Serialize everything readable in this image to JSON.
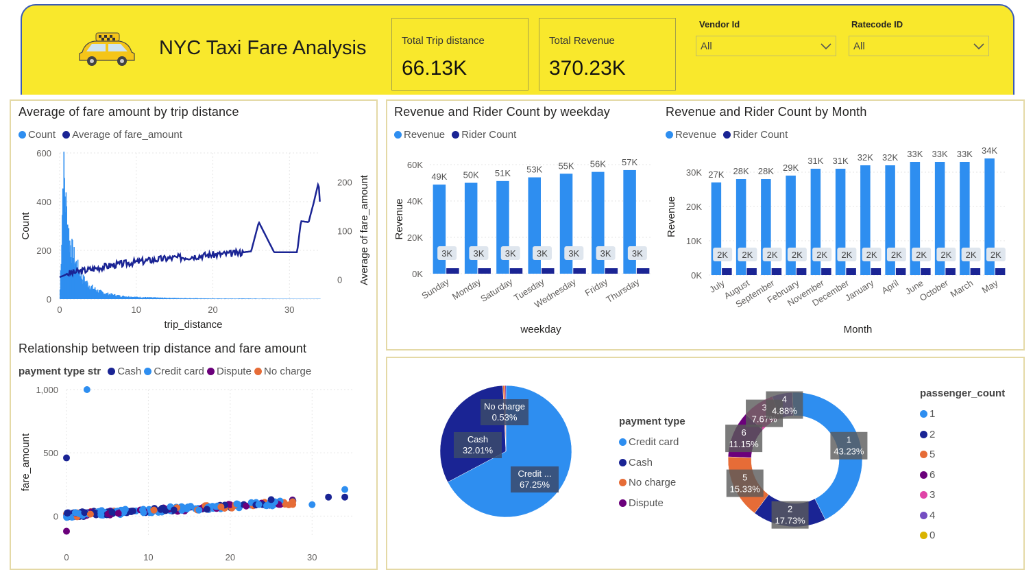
{
  "header": {
    "title": "NYC Taxi Fare Analysis",
    "kpis": [
      {
        "label": "Total Trip distance",
        "value": "66.13K"
      },
      {
        "label": "Total Revenue",
        "value": "370.23K"
      }
    ],
    "slicers": [
      {
        "label": "Vendor Id",
        "value": "All"
      },
      {
        "label": "Ratecode ID",
        "value": "All"
      }
    ]
  },
  "colors": {
    "light_blue": "#2e8ef0",
    "navy": "#1a2494",
    "orange": "#e66c37",
    "purple": "#6b007b",
    "pink": "#e044a7",
    "violet": "#744ec2",
    "gold": "#d9b300",
    "header_bg": "#f9e82c"
  },
  "chart_data": [
    {
      "id": "fare_by_distance",
      "type": "combo",
      "title": "Average of fare amount by trip distance",
      "legend": [
        "Count",
        "Average of fare_amount"
      ],
      "xlabel": "trip_distance",
      "ylabel": "Count",
      "y2label": "Average of fare_amount",
      "xlim": [
        0,
        34
      ],
      "ylim": [
        0,
        600
      ],
      "y2lim": [
        -40,
        260
      ],
      "xticks": [
        "0",
        "10",
        "20",
        "30"
      ],
      "yticks": [
        "0",
        "200",
        "400",
        "600"
      ],
      "y2ticks": [
        "0",
        "100",
        "200"
      ],
      "count_hist": {
        "x": [
          0,
          0.2,
          0.4,
          0.6,
          0.8,
          1,
          1.2,
          1.5,
          2,
          2.5,
          3,
          4,
          5,
          6,
          8,
          10,
          12,
          15,
          20,
          25,
          30,
          34
        ],
        "y": [
          40,
          250,
          520,
          460,
          360,
          300,
          240,
          200,
          150,
          110,
          80,
          50,
          32,
          22,
          12,
          8,
          6,
          4,
          2,
          2,
          1,
          1
        ]
      },
      "avg_line": {
        "x": [
          0,
          0.5,
          1,
          2,
          3,
          5,
          7,
          10,
          13,
          16,
          19,
          21,
          23,
          25,
          26,
          28,
          29,
          30,
          31,
          31.5,
          32.5,
          33.2,
          33.8,
          34
        ],
        "y": [
          5,
          8,
          12,
          15,
          18,
          24,
          30,
          36,
          42,
          46,
          50,
          52,
          54,
          58,
          118,
          56,
          56,
          56,
          56,
          120,
          118,
          160,
          200,
          150
        ]
      }
    },
    {
      "id": "revenue_by_weekday",
      "type": "bar",
      "title": "Revenue and Rider Count by weekday",
      "legend": [
        "Revenue",
        "Rider Count"
      ],
      "xlabel": "weekday",
      "ylabel": "Revenue",
      "ylim": [
        0,
        60000
      ],
      "yticks": [
        "0K",
        "20K",
        "40K",
        "60K"
      ],
      "categories": [
        "Sunday",
        "Monday",
        "Saturday",
        "Tuesday",
        "Wednesday",
        "Friday",
        "Thursday"
      ],
      "series": [
        {
          "name": "Revenue",
          "values": [
            49000,
            50000,
            51000,
            53000,
            55000,
            56000,
            57000
          ],
          "labels": [
            "49K",
            "50K",
            "51K",
            "53K",
            "55K",
            "56K",
            "57K"
          ]
        },
        {
          "name": "Rider Count",
          "values": [
            3000,
            3000,
            3000,
            3000,
            3000,
            3000,
            3000
          ],
          "labels": [
            "3K",
            "3K",
            "3K",
            "3K",
            "3K",
            "3K",
            "3K"
          ]
        }
      ]
    },
    {
      "id": "revenue_by_month",
      "type": "bar",
      "title": "Revenue and Rider Count by Month",
      "legend": [
        "Revenue",
        "Rider Count"
      ],
      "xlabel": "Month",
      "ylabel": "Revenue",
      "ylim": [
        0,
        34000
      ],
      "yticks": [
        "0K",
        "10K",
        "20K",
        "30K"
      ],
      "categories": [
        "July",
        "August",
        "September",
        "February",
        "November",
        "December",
        "January",
        "April",
        "June",
        "October",
        "March",
        "May"
      ],
      "series": [
        {
          "name": "Revenue",
          "values": [
            27000,
            28000,
            28000,
            29000,
            31000,
            31000,
            32000,
            32000,
            33000,
            33000,
            33000,
            34000
          ],
          "labels": [
            "27K",
            "28K",
            "28K",
            "29K",
            "31K",
            "31K",
            "32K",
            "32K",
            "33K",
            "33K",
            "33K",
            "34K"
          ]
        },
        {
          "name": "Rider Count",
          "values": [
            2000,
            2000,
            2000,
            2000,
            2000,
            2000,
            2000,
            2000,
            2000,
            2000,
            2000,
            2000
          ],
          "labels": [
            "2K",
            "2K",
            "2K",
            "2K",
            "2K",
            "2K",
            "2K",
            "2K",
            "2K",
            "2K",
            "2K",
            "2K"
          ]
        }
      ]
    },
    {
      "id": "distance_vs_fare",
      "type": "scatter",
      "title": "Relationship between trip distance and fare amount",
      "legend_title": "payment type str",
      "legend": [
        "Cash",
        "Credit card",
        "Dispute",
        "No charge"
      ],
      "xlabel": "trip_distance",
      "ylabel": "fare_amount",
      "xlim": [
        0,
        35
      ],
      "ylim": [
        -150,
        1000
      ],
      "xticks": [
        "0",
        "10",
        "20",
        "30"
      ],
      "yticks": [
        "0",
        "500",
        "1,000"
      ],
      "outliers": [
        {
          "type": "Credit card",
          "x": 2.5,
          "y": 1000
        },
        {
          "type": "Cash",
          "x": 0,
          "y": 460
        },
        {
          "type": "Dispute",
          "x": 0,
          "y": -120
        },
        {
          "type": "Cash",
          "x": 32,
          "y": 150
        },
        {
          "type": "Credit card",
          "x": 34,
          "y": 210
        },
        {
          "type": "Cash",
          "x": 34,
          "y": 150
        },
        {
          "type": "Cash",
          "x": 25,
          "y": 130
        },
        {
          "type": "Credit card",
          "x": 30,
          "y": 90
        }
      ]
    },
    {
      "id": "payment_type_pie",
      "type": "pie",
      "legend_title": "payment type",
      "legend": [
        "Credit card",
        "Cash",
        "No charge",
        "Dispute"
      ],
      "slices": [
        {
          "name": "Credit card",
          "value": 67.25,
          "label_name": "Credit ...",
          "label_pct": "67.25%"
        },
        {
          "name": "Cash",
          "value": 32.01,
          "label_name": "Cash",
          "label_pct": "32.01%"
        },
        {
          "name": "No charge",
          "value": 0.53,
          "label_name": "No charge",
          "label_pct": "0.53%"
        },
        {
          "name": "Dispute",
          "value": 0.21,
          "label_name": "",
          "label_pct": ""
        }
      ]
    },
    {
      "id": "passenger_count_donut",
      "type": "pie",
      "legend_title": "passenger_count",
      "legend": [
        "1",
        "2",
        "5",
        "6",
        "3",
        "4",
        "0"
      ],
      "slices": [
        {
          "name": "1",
          "value": 43.23,
          "label_pct": "43.23%"
        },
        {
          "name": "2",
          "value": 17.73,
          "label_pct": "17.73%"
        },
        {
          "name": "5",
          "value": 15.33,
          "label_pct": "15.33%"
        },
        {
          "name": "6",
          "value": 11.15,
          "label_pct": "11.15%"
        },
        {
          "name": "3",
          "value": 7.67,
          "label_pct": "7.67%"
        },
        {
          "name": "4",
          "value": 4.88,
          "label_pct": "4.88%"
        },
        {
          "name": "0",
          "value": 0.01,
          "label_pct": ""
        }
      ]
    }
  ]
}
